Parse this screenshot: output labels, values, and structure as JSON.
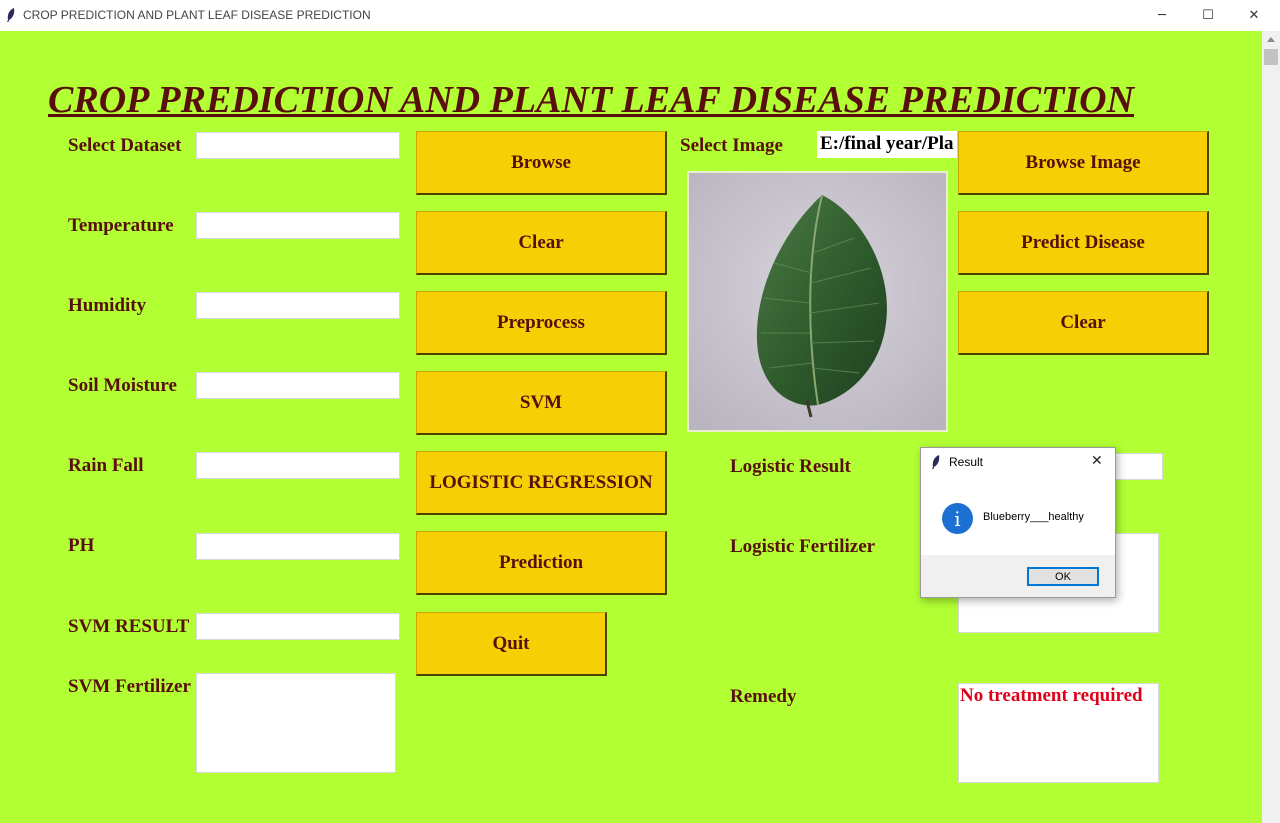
{
  "window": {
    "title": "CROP PREDICTION AND PLANT LEAF DISEASE PREDICTION",
    "minimize_glyph": "─",
    "maximize_glyph": "☐",
    "close_glyph": "✕"
  },
  "heading": "CROP PREDICTION AND PLANT LEAF DISEASE PREDICTION",
  "labels": {
    "select_dataset": "Select Dataset",
    "temperature": "Temperature",
    "humidity": "Humidity",
    "soil_moisture": "Soil Moisture",
    "rain_fall": "Rain Fall",
    "ph": "PH",
    "svm_result": "SVM RESULT",
    "svm_fertilizer": "SVM Fertilizer",
    "select_image": "Select Image",
    "logistic_result": "Logistic Result",
    "logistic_fertilizer": "Logistic Fertilizer",
    "remedy": "Remedy"
  },
  "buttons": {
    "browse": "Browse",
    "clear_left": "Clear",
    "preprocess": "Preprocess",
    "svm": "SVM",
    "logistic_regression": "LOGISTIC REGRESSION",
    "prediction": "Prediction",
    "quit": "Quit",
    "browse_image": "Browse Image",
    "predict_disease": "Predict Disease",
    "clear_right": "Clear"
  },
  "fields": {
    "image_path": "E:/final year/Pla",
    "remedy_text": "No treatment required"
  },
  "dialog": {
    "title": "Result",
    "message": "Blueberry___healthy",
    "ok": "OK",
    "close_glyph": "✕",
    "info_glyph": "i"
  },
  "colors": {
    "background": "#b2ff33",
    "button": "#f7cf05",
    "label_text": "#5a0f0f",
    "remedy_text": "#e0001a",
    "info_icon": "#1c70d2"
  },
  "icons": [
    "feather-app-icon",
    "minimize-icon",
    "maximize-icon",
    "close-icon",
    "info-icon",
    "leaf-image"
  ]
}
